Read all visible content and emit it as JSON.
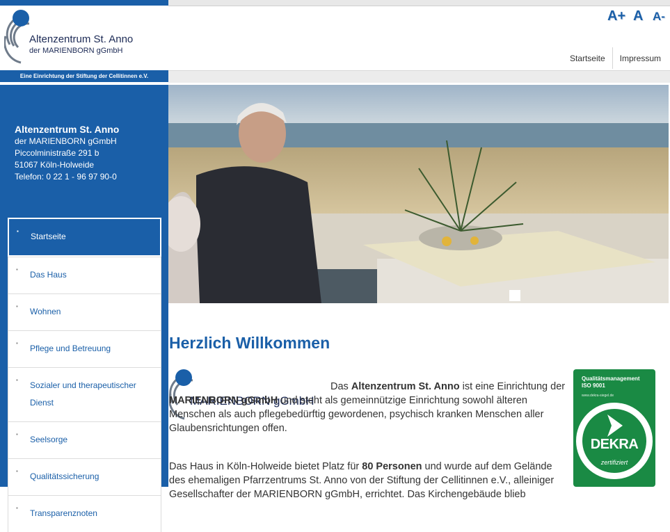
{
  "header": {
    "logo_line1": "Altenzentrum St. Anno",
    "logo_line2": "der MARIENBORN gGmbH",
    "stiftung": "Eine Einrichtung der Stiftung der Cellitinnen e.V.",
    "font_controls": {
      "increase": "A+",
      "normal": "A",
      "decrease": "A-"
    },
    "topnav": [
      {
        "label": "Startseite"
      },
      {
        "label": "Impressum"
      }
    ]
  },
  "sidebar": {
    "address": {
      "name": "Altenzentrum St. Anno",
      "org": "der MARIENBORN gGmbH",
      "street": "Piccolministraße 291 b",
      "city": "51067 Köln-Holweide",
      "phone": "Telefon:  0 22 1 - 96 97 90-0"
    },
    "nav": [
      {
        "label": "Startseite",
        "active": true
      },
      {
        "label": "Das Haus"
      },
      {
        "label": "Wohnen"
      },
      {
        "label": "Pflege und Betreuung"
      },
      {
        "label": "Sozialer und therapeutischer Dienst"
      },
      {
        "label": "Seelsorge"
      },
      {
        "label": "Qualitätssicherung"
      },
      {
        "label": "Transparenznoten"
      }
    ]
  },
  "main": {
    "heading": "Herzlich Willkommen",
    "marienborn_logo_text": "MARIENBORN gGmbH",
    "p1": {
      "t1": "Das ",
      "b1": "Altenzentrum St. Anno",
      "t2": " ist eine Einrichtung der ",
      "b2": "MARIENBORN gGmbH",
      "t3": "  und steht als gemeinnützige Einrichtung sowohl älteren Menschen als auch pflegebedürftig gewordenen, psychisch kranken Menschen aller Glaubensrichtungen offen."
    },
    "p2": {
      "t1": "Das Haus in Köln-Holweide bietet Platz für ",
      "b1": "80 Personen",
      "t2": " und wurde auf dem Gelände des ehemaligen Pfarrzentrums St. Anno von der Stiftung der Cellitinnen e.V., alleiniger Gesellschafter der MARIENBORN gGmbH,  errichtet. Das Kirchengebäude blieb"
    },
    "dekra": {
      "line1": "Qualitätsmanagement",
      "line2": "ISO 9001",
      "url": "www.dekra-siegel.de",
      "word": "DEKRA",
      "zert": "zertifiziert"
    }
  },
  "colors": {
    "brand_blue": "#1a5fa8",
    "dekra_green": "#1a8a44",
    "text": "#333333"
  }
}
